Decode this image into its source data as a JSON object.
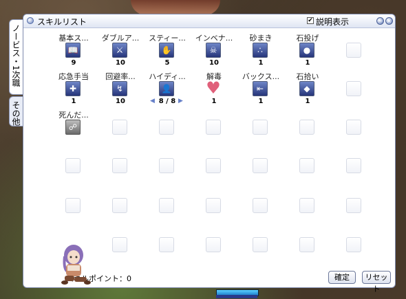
{
  "window": {
    "title": "スキルリスト",
    "desc_checkbox_label": "説明表示",
    "desc_checkbox_checked": "✔",
    "minimize_glyph": "−",
    "close_glyph": "×"
  },
  "tabs": [
    {
      "label": "ノービス・1次職",
      "active": true
    },
    {
      "label": "その他",
      "active": false
    }
  ],
  "skills": [
    {
      "name": "基本ス...",
      "level": "9",
      "icon": "book-icon"
    },
    {
      "name": "ダブルア...",
      "level": "10",
      "icon": "double-attack-icon"
    },
    {
      "name": "スティー...",
      "level": "5",
      "icon": "steal-icon"
    },
    {
      "name": "インベナ...",
      "level": "10",
      "icon": "envenom-icon"
    },
    {
      "name": "砂まき",
      "level": "1",
      "icon": "sand-icon"
    },
    {
      "name": "石投げ",
      "level": "1",
      "icon": "stone-throw-icon"
    },
    {
      "name": "応急手当",
      "level": "1",
      "icon": "first-aid-icon"
    },
    {
      "name": "回避率...",
      "level": "10",
      "icon": "flee-icon"
    },
    {
      "name": "ハイディ...",
      "level": "8 / 8",
      "icon": "hiding-icon",
      "has_arrows": true
    },
    {
      "name": "解毒",
      "level": "1",
      "icon": "detox-heart-icon"
    },
    {
      "name": "バックス...",
      "level": "1",
      "icon": "backslide-icon"
    },
    {
      "name": "石拾い",
      "level": "1",
      "icon": "pick-stone-icon"
    },
    {
      "name": "死んだ...",
      "level": "",
      "icon": "play-dead-icon"
    }
  ],
  "footer": {
    "skill_points": "スキルポイント：0",
    "ok_button": "確定",
    "reset_button": "リセット"
  }
}
